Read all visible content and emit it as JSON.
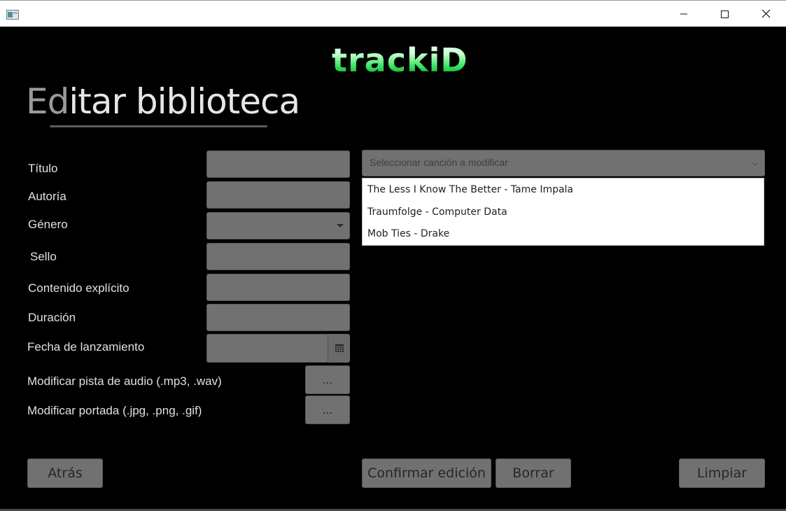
{
  "window": {
    "app_icon": "window-app-icon",
    "controls": [
      "minimize-icon",
      "maximize-icon",
      "close-icon"
    ]
  },
  "logo": "trackiD",
  "heading": {
    "part1": "Ed",
    "part2": "itar biblioteca"
  },
  "form": {
    "titulo": "Título",
    "autoria": "Autoría",
    "genero": "Género",
    "sello": "Sello",
    "explicito": "Contenido explícito",
    "duracion": "Duración",
    "fecha": "Fecha de lanzamiento",
    "audio": "Modificar pista de audio (.mp3, .wav)",
    "portada": "Modificar portada (.jpg, .png, .gif)",
    "browse_label": "..."
  },
  "song_selector": {
    "placeholder": "Seleccionar canción a modificar",
    "options": [
      "The Less I Know The Better - Tame Impala",
      "Traumfolge - Computer Data",
      "Mob Ties - Drake"
    ]
  },
  "buttons": {
    "atras": "Atrás",
    "confirmar": "Confirmar edición",
    "borrar": "Borrar",
    "limpiar": "Limpiar"
  },
  "colors": {
    "background": "#000000",
    "field": "#717171",
    "logo_accent": "#34e35c"
  }
}
